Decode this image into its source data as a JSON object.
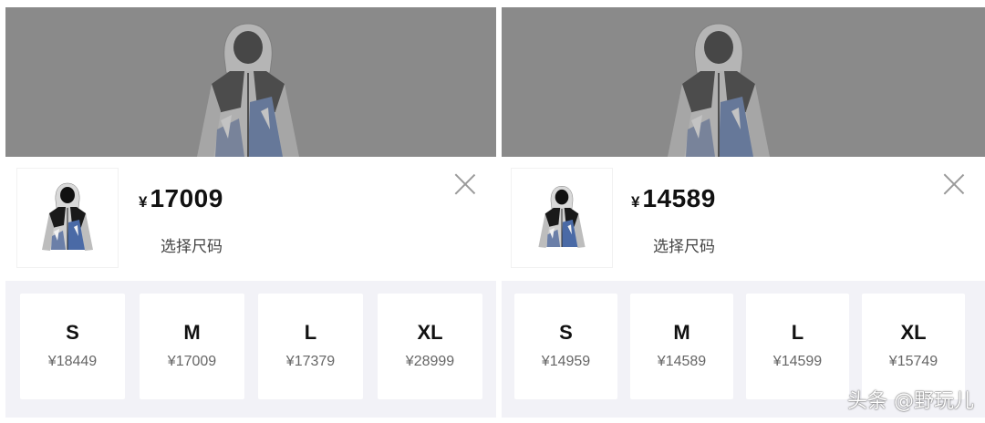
{
  "panels": [
    {
      "currency": "¥",
      "price": "17009",
      "select_size": "选择尺码",
      "sizes": [
        {
          "label": "S",
          "price": "¥18449"
        },
        {
          "label": "M",
          "price": "¥17009"
        },
        {
          "label": "L",
          "price": "¥17379"
        },
        {
          "label": "XL",
          "price": "¥28999"
        }
      ]
    },
    {
      "currency": "¥",
      "price": "14589",
      "select_size": "选择尺码",
      "sizes": [
        {
          "label": "S",
          "price": "¥14959"
        },
        {
          "label": "M",
          "price": "¥14589"
        },
        {
          "label": "L",
          "price": "¥14599"
        },
        {
          "label": "XL",
          "price": "¥15749"
        }
      ]
    }
  ],
  "watermark": "头条 @野玩儿",
  "colors": {
    "backdrop": "#8a8a8a",
    "size_area": "#f2f2f7",
    "jacket_black": "#1a1a1a",
    "jacket_blue": "#4a6aa6"
  }
}
